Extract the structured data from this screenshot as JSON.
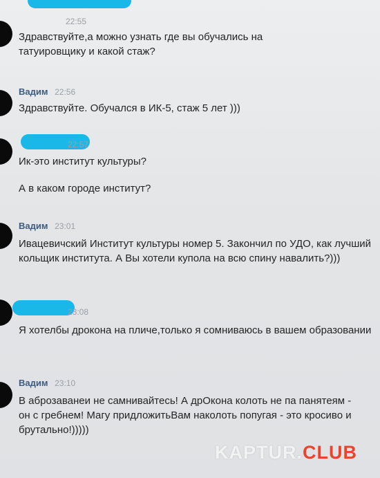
{
  "messages": [
    {
      "sender": "",
      "time": "22:55",
      "redacted": true,
      "paragraphs": [
        "Здравствуйте,а можно узнать где вы обучались на татуировщику и какой стаж?"
      ]
    },
    {
      "sender": "Вадим",
      "time": "22:56",
      "redacted": false,
      "paragraphs": [
        "Здравствуйте. Обучался в ИК-5, стаж 5 лет )))"
      ]
    },
    {
      "sender": "",
      "time": "22:57",
      "redacted": true,
      "paragraphs": [
        "Ик-это институт культуры?",
        "А в каком городе институт?"
      ]
    },
    {
      "sender": "Вадим",
      "time": "23:01",
      "redacted": false,
      "paragraphs": [
        "Ивацевичский Институт культуры номер 5. Закончил по УДО, как лучший кольщик института. А Вы хотели купола на всю спину навалить?)))"
      ]
    },
    {
      "sender": "",
      "time": "23:08",
      "redacted": true,
      "paragraphs": [
        "Я хотелбы дрокона на пличе,только я сомниваюсь в вашем образовании"
      ]
    },
    {
      "sender": "Вадим",
      "time": "23:10",
      "redacted": false,
      "paragraphs": [
        "В аброзаванеи не самнивайтесь! А дрОкона колоть не па панятеям - он с гребнем! Магу придложитьВам наколоть попугая - это кросиво и брутально!)))))"
      ]
    }
  ],
  "watermark": {
    "part1": "KAPTUR.",
    "part2": "CLUB"
  },
  "colors": {
    "name": "#3d5c80",
    "time": "#9aa0a6",
    "redaction": "#1ab8e8",
    "watermark_accent": "#e8452f"
  }
}
